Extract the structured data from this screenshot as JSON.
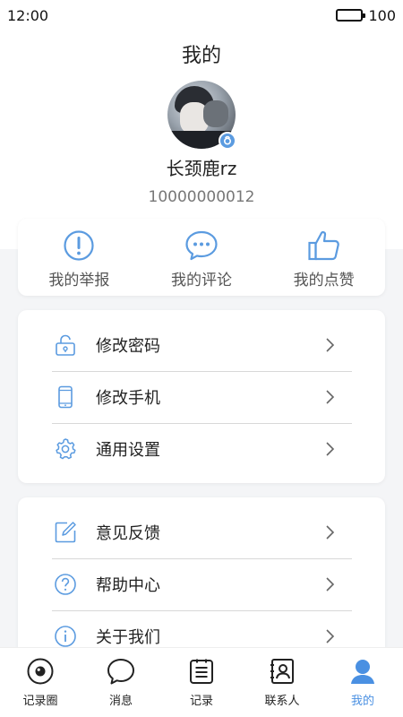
{
  "status_bar": {
    "time": "12:00",
    "battery": "100"
  },
  "header": {
    "title": "我的"
  },
  "profile": {
    "name": "长颈鹿rz",
    "id": "10000000012"
  },
  "quick_actions": [
    {
      "label": "我的举报",
      "icon": "report-icon"
    },
    {
      "label": "我的评论",
      "icon": "comment-icon"
    },
    {
      "label": "我的点赞",
      "icon": "like-icon"
    }
  ],
  "menu_group_1": [
    {
      "label": "修改密码",
      "icon": "lock-icon"
    },
    {
      "label": "修改手机",
      "icon": "phone-icon"
    },
    {
      "label": "通用设置",
      "icon": "gear-icon"
    }
  ],
  "menu_group_2": [
    {
      "label": "意见反馈",
      "icon": "feedback-icon"
    },
    {
      "label": "帮助中心",
      "icon": "help-icon"
    },
    {
      "label": "关于我们",
      "icon": "info-icon"
    }
  ],
  "tabbar": [
    {
      "label": "记录圈",
      "icon": "eye-icon"
    },
    {
      "label": "消息",
      "icon": "chat-icon"
    },
    {
      "label": "记录",
      "icon": "notes-icon"
    },
    {
      "label": "联系人",
      "icon": "contacts-icon"
    },
    {
      "label": "我的",
      "icon": "person-icon",
      "active": true
    }
  ],
  "colors": {
    "accent": "#4a90e2",
    "icon_blue": "#5b9be0",
    "background": "#f4f5f7"
  }
}
